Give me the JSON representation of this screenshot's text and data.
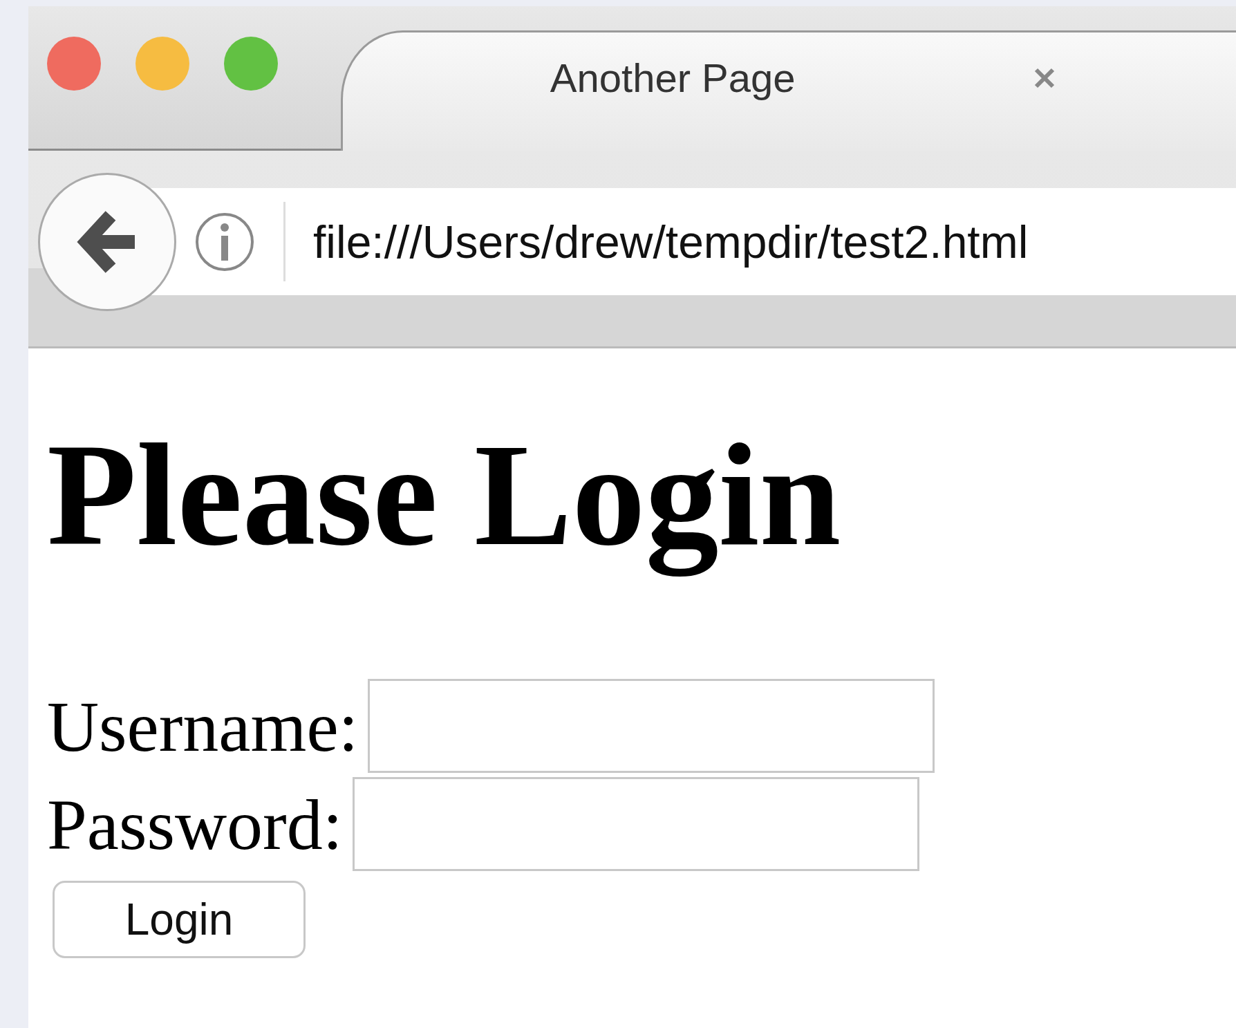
{
  "tab": {
    "title": "Another Page"
  },
  "address_bar": {
    "url": "file:///Users/drew/tempdir/test2.html"
  },
  "page": {
    "heading": "Please Login",
    "fields": [
      {
        "label": "Username:"
      },
      {
        "label": "Password:"
      }
    ],
    "button": "Login"
  }
}
